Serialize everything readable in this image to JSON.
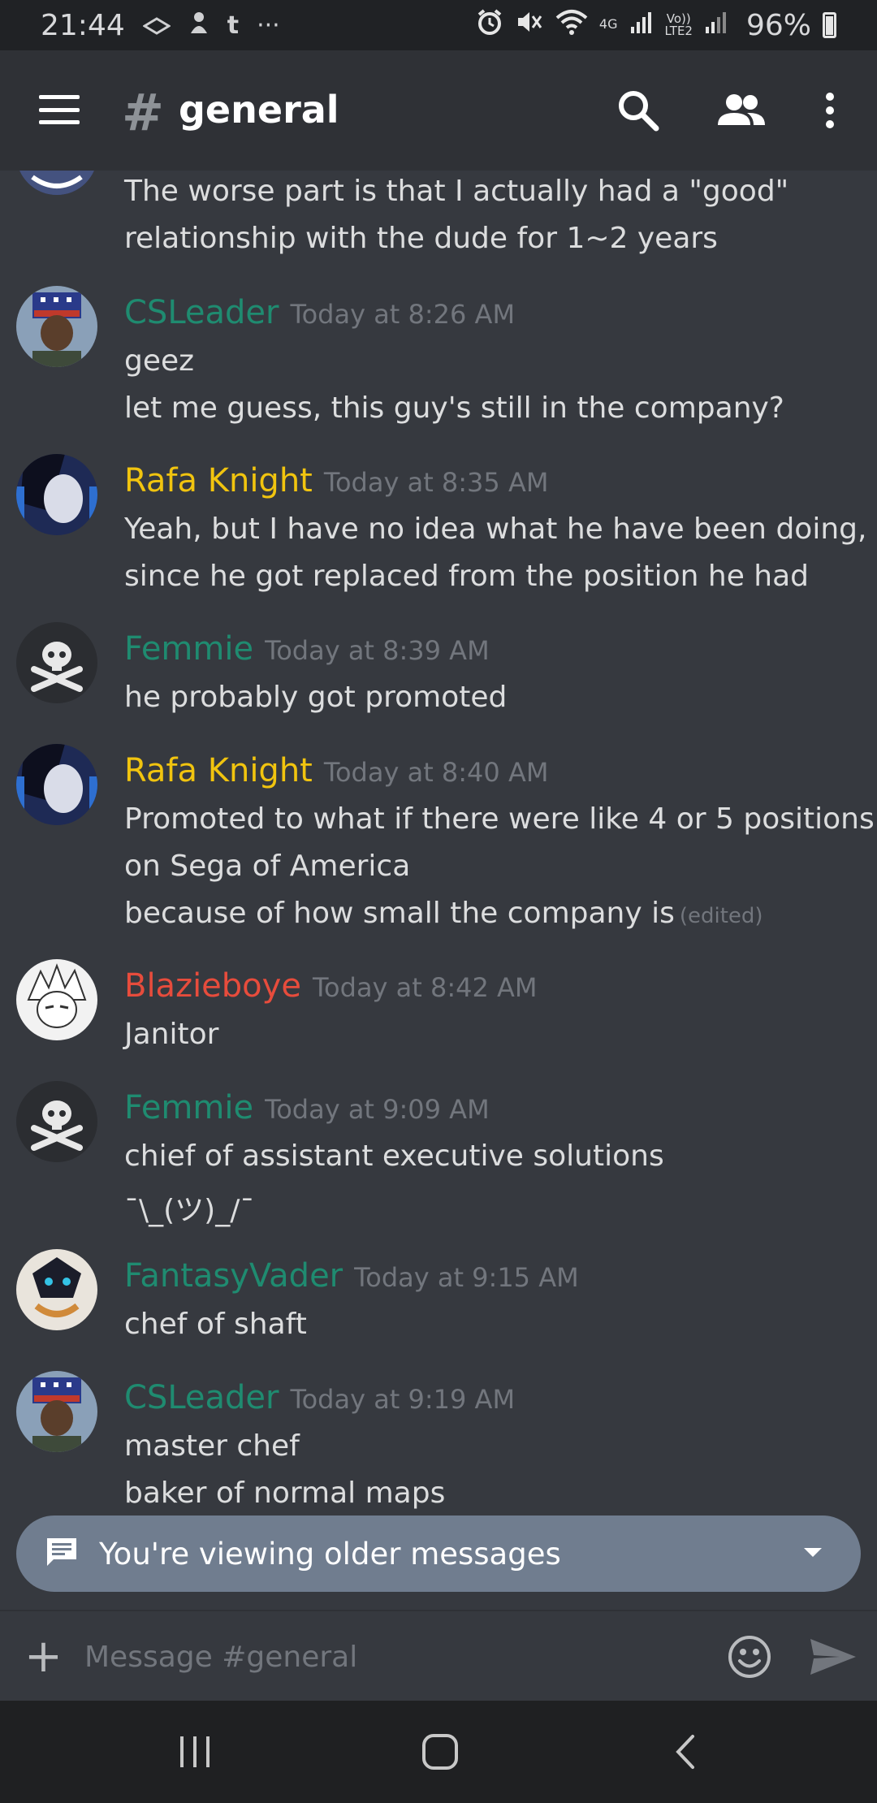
{
  "status_bar": {
    "time": "21:44",
    "left_icons": [
      "diamond-icon",
      "squirrel-icon",
      "tumblr-icon",
      "more-dots-icon"
    ],
    "tumblr_glyph": "t",
    "dots_glyph": "···",
    "net_4g": "4G",
    "volte": "Vo))",
    "lte2": "LTE2",
    "battery": "96%"
  },
  "header": {
    "hash": "#",
    "channel": "general"
  },
  "messages": [
    {
      "kind": "continuation",
      "lines": [
        "The worse part is that I actually had a \"good\"",
        "relationship with the dude for 1~2 years"
      ]
    },
    {
      "author": "CSLeader",
      "author_color": "#1f8b70",
      "time": "Today at 8:26 AM",
      "lines": [
        "geez",
        "let me guess, this guy's still in the company?"
      ]
    },
    {
      "author": "Rafa Knight",
      "author_color": "#f1c40f",
      "time": "Today at 8:35 AM",
      "lines": [
        "Yeah, but I have no idea what he have been doing,",
        "since he got replaced from the position he had"
      ]
    },
    {
      "author": "Femmie",
      "author_color": "#1f8b70",
      "time": "Today at 8:39 AM",
      "lines": [
        "he probably got promoted"
      ]
    },
    {
      "author": "Rafa Knight",
      "author_color": "#f1c40f",
      "time": "Today at 8:40 AM",
      "lines": [
        "Promoted to what if there were like 4 or 5 positions",
        "on Sega of America",
        "because of how small the company is"
      ],
      "edited": "(edited)"
    },
    {
      "author": "Blazieboye",
      "author_color": "#e74c3c",
      "time": "Today at 8:42 AM",
      "lines": [
        "Janitor"
      ]
    },
    {
      "author": "Femmie",
      "author_color": "#1f8b70",
      "time": "Today at 9:09 AM",
      "lines": [
        "chief of assistant executive solutions",
        "¯\\_(ツ)_/¯"
      ]
    },
    {
      "author": "FantasyVader",
      "author_color": "#1f8b70",
      "time": "Today at 9:15 AM",
      "lines": [
        "chef of shaft"
      ]
    },
    {
      "author": "CSLeader",
      "author_color": "#1f8b70",
      "time": "Today at 9:19 AM",
      "lines": [
        "master chef",
        "baker of normal maps"
      ]
    }
  ],
  "older_banner": {
    "text": "You're viewing older messages"
  },
  "composer": {
    "placeholder": "Message #general",
    "plus": "+"
  },
  "colors": {
    "background": "#36393f",
    "header": "#2f3136",
    "banner": "#707d8f",
    "muted": "#72767d"
  }
}
